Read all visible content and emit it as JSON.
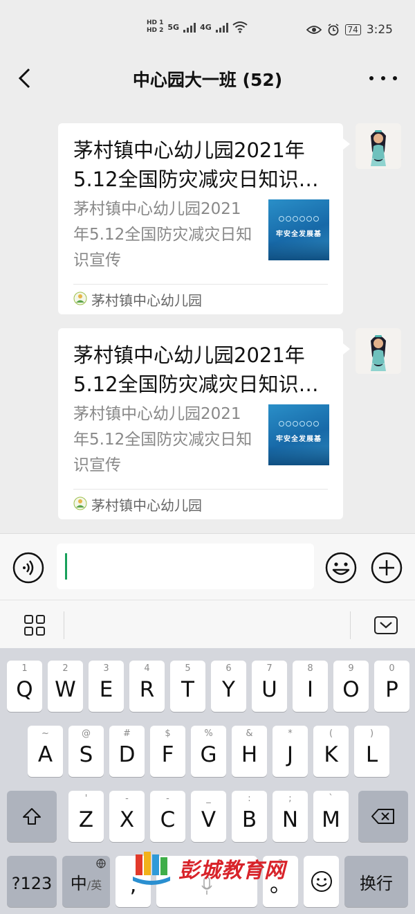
{
  "status_bar": {
    "sim1": "HD 1",
    "sim2": "HD 2",
    "net1": "5G",
    "net2": "4G",
    "battery": "74",
    "time": "3:25"
  },
  "nav": {
    "title": "中心园大一班 (52)"
  },
  "messages": [
    {
      "title": "茅村镇中心幼儿园2021年5.12全国防灾减灾日知识…",
      "description": "茅村镇中心幼儿园2021年5.12全国防灾减灾日知识宣传",
      "thumb_title": "牢安全发展基",
      "source": "茅村镇中心幼儿园"
    },
    {
      "title": "茅村镇中心幼儿园2021年5.12全国防灾减灾日知识…",
      "description": "茅村镇中心幼儿园2021年5.12全国防灾减灾日知识宣传",
      "thumb_title": "牢安全发展基",
      "source": "茅村镇中心幼儿园"
    }
  ],
  "keyboard": {
    "row1": [
      {
        "sub": "1",
        "main": "Q"
      },
      {
        "sub": "2",
        "main": "W"
      },
      {
        "sub": "3",
        "main": "E"
      },
      {
        "sub": "4",
        "main": "R"
      },
      {
        "sub": "5",
        "main": "T"
      },
      {
        "sub": "6",
        "main": "Y"
      },
      {
        "sub": "7",
        "main": "U"
      },
      {
        "sub": "8",
        "main": "I"
      },
      {
        "sub": "9",
        "main": "O"
      },
      {
        "sub": "0",
        "main": "P"
      }
    ],
    "row2": [
      {
        "sub": "~",
        "main": "A"
      },
      {
        "sub": "@",
        "main": "S"
      },
      {
        "sub": "#",
        "main": "D"
      },
      {
        "sub": "$",
        "main": "F"
      },
      {
        "sub": "%",
        "main": "G"
      },
      {
        "sub": "&",
        "main": "H"
      },
      {
        "sub": "*",
        "main": "J"
      },
      {
        "sub": "(",
        "main": "K"
      },
      {
        "sub": ")",
        "main": "L"
      }
    ],
    "row3": [
      {
        "sub": "'",
        "main": "Z"
      },
      {
        "sub": "-",
        "main": "X"
      },
      {
        "sub": "-",
        "main": "C"
      },
      {
        "sub": "_",
        "main": "V"
      },
      {
        "sub": ":",
        "main": "B"
      },
      {
        "sub": ";",
        "main": "N"
      },
      {
        "sub": "`",
        "main": "M"
      }
    ],
    "num_key": "?123",
    "lang_key": "中",
    "lang_sub": "/英",
    "comma_key": ",",
    "period_sub": "?",
    "period_key": "。",
    "enter_key": "换行"
  },
  "watermark": "彭城教育网"
}
